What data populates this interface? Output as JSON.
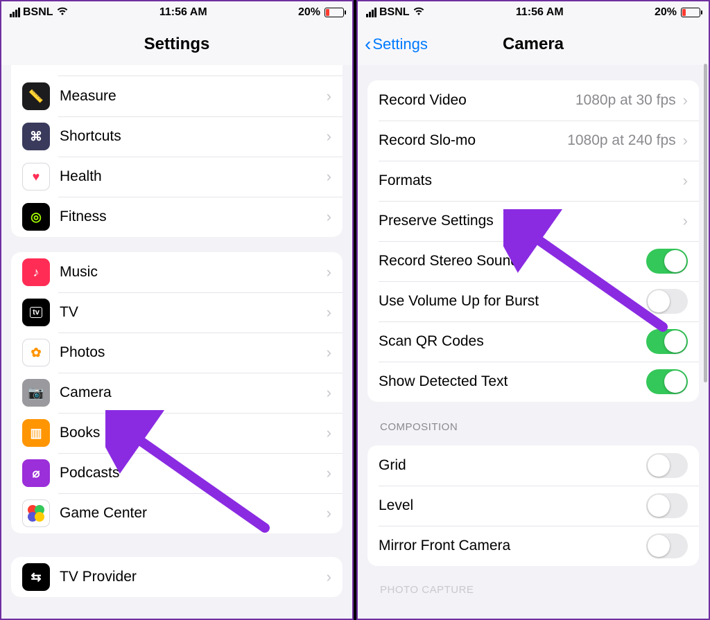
{
  "status": {
    "carrier": "BSNL",
    "time": "11:56 AM",
    "battery": "20%"
  },
  "left": {
    "title": "Settings",
    "group1": [
      {
        "label": "Measure",
        "icon_bg": "#1c1c1e",
        "icon_glyph": "📏"
      },
      {
        "label": "Shortcuts",
        "icon_bg": "#3a3a5c",
        "icon_glyph": "⌘"
      },
      {
        "label": "Health",
        "icon_bg": "#ffffff",
        "icon_glyph": "♥",
        "icon_fg": "#ff2d55",
        "border": true
      },
      {
        "label": "Fitness",
        "icon_bg": "#000000",
        "icon_glyph": "◎",
        "icon_fg": "#a6ff00"
      }
    ],
    "group2": [
      {
        "label": "Music",
        "icon_bg": "#ff2d55",
        "icon_glyph": "♪"
      },
      {
        "label": "TV",
        "icon_bg": "#000000",
        "icon_glyph": "tv",
        "small": true
      },
      {
        "label": "Photos",
        "icon_bg": "#ffffff",
        "icon_glyph": "✿",
        "icon_fg": "#ff9500",
        "border": true
      },
      {
        "label": "Camera",
        "icon_bg": "#9a9a9e",
        "icon_glyph": "📷"
      },
      {
        "label": "Books",
        "icon_bg": "#ff9500",
        "icon_glyph": "▥"
      },
      {
        "label": "Podcasts",
        "icon_bg": "#9b2fd9",
        "icon_glyph": "⌀"
      },
      {
        "label": "Game Center",
        "icon_bg": "#ffffff",
        "icon_glyph": "●",
        "multicolor": true,
        "border": true
      }
    ],
    "group3": [
      {
        "label": "TV Provider",
        "icon_bg": "#000000",
        "icon_glyph": "⇆"
      }
    ]
  },
  "right": {
    "back": "Settings",
    "title": "Camera",
    "section1": [
      {
        "label": "Record Video",
        "value": "1080p at 30 fps",
        "type": "link"
      },
      {
        "label": "Record Slo-mo",
        "value": "1080p at 240 fps",
        "type": "link"
      },
      {
        "label": "Formats",
        "type": "link"
      },
      {
        "label": "Preserve Settings",
        "type": "link"
      },
      {
        "label": "Record Stereo Sound",
        "type": "switch",
        "on": true
      },
      {
        "label": "Use Volume Up for Burst",
        "type": "switch",
        "on": false
      },
      {
        "label": "Scan QR Codes",
        "type": "switch",
        "on": true
      },
      {
        "label": "Show Detected Text",
        "type": "switch",
        "on": true
      }
    ],
    "section2_header": "Composition",
    "section2": [
      {
        "label": "Grid",
        "type": "switch",
        "on": false
      },
      {
        "label": "Level",
        "type": "switch",
        "on": false
      },
      {
        "label": "Mirror Front Camera",
        "type": "switch",
        "on": false
      }
    ],
    "section3_header_partial": "PHOTO CAPTURE"
  }
}
